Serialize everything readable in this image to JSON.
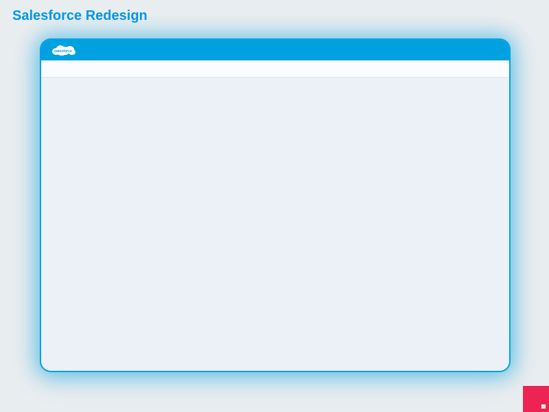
{
  "page": {
    "title": "Salesforce Redesign"
  },
  "header": {
    "logoText": "salesforce"
  },
  "colors": {
    "accent": "#00a1e0",
    "badge": "#ed2353",
    "background": "#e8edf0",
    "content": "#ecf1f8"
  }
}
